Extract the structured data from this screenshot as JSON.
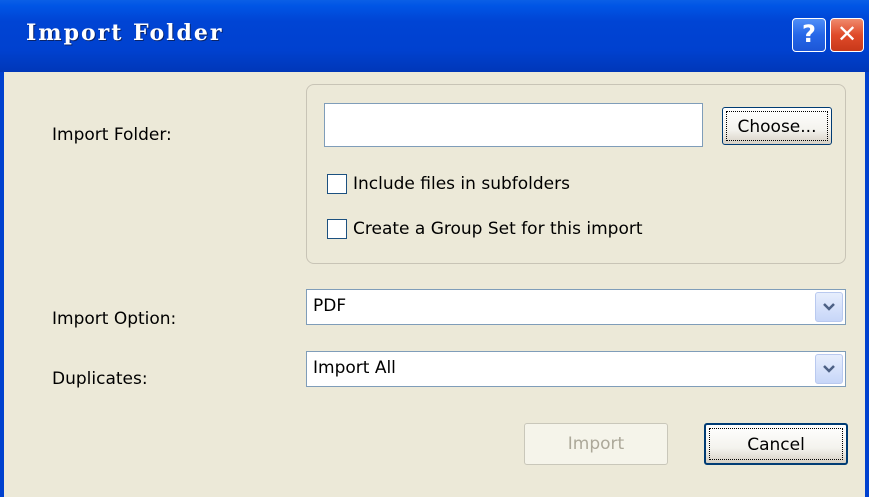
{
  "window": {
    "title": "Import Folder",
    "help_label": "?",
    "close_label": "✕"
  },
  "import_folder": {
    "label": "Import Folder:",
    "path_value": "",
    "choose_label": "Choose...",
    "include_subfolders_label": "Include files in subfolders",
    "include_subfolders_checked": false,
    "group_set_label": "Create a Group Set for this import",
    "group_set_checked": false
  },
  "import_option": {
    "label": "Import Option:",
    "selected": "PDF"
  },
  "duplicates": {
    "label": "Duplicates:",
    "selected": "Import All"
  },
  "actions": {
    "import_label": "Import",
    "import_enabled": false,
    "cancel_label": "Cancel"
  },
  "colors": {
    "titlebar": "#0041cf",
    "window_bg": "#ece9d8",
    "close_button": "#e04b2a",
    "help_button": "#2667e8"
  },
  "icons": {
    "help": "help-icon",
    "close": "close-icon",
    "dropdown": "chevron-down-icon"
  }
}
